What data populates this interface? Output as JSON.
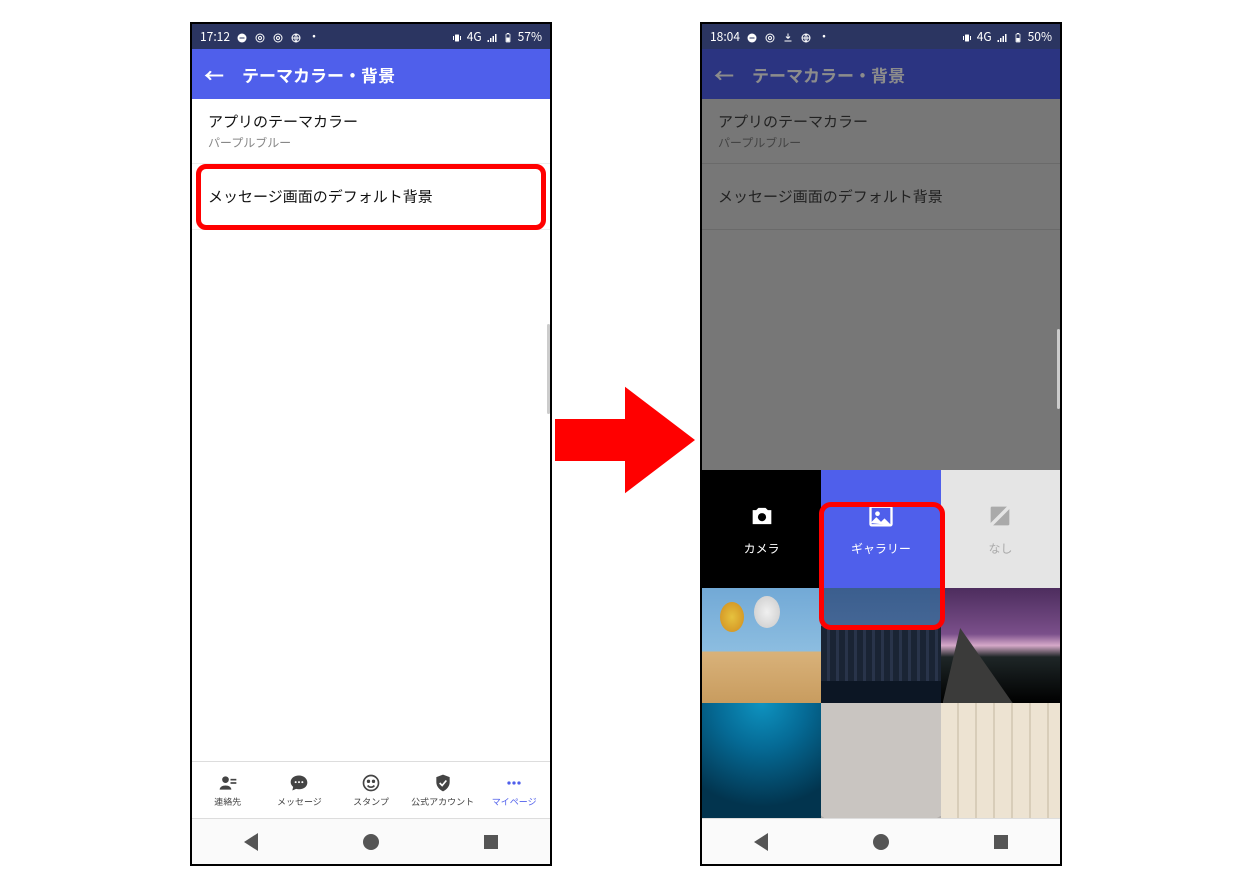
{
  "left_phone": {
    "status": {
      "time": "17:12",
      "network": "4G",
      "battery": "57%"
    },
    "header_title": "テーマカラー・背景",
    "row_theme": {
      "title": "アプリのテーマカラー",
      "sub": "パープルブルー"
    },
    "row_bg": {
      "title": "メッセージ画面のデフォルト背景"
    },
    "tabs": {
      "contacts": "連絡先",
      "messages": "メッセージ",
      "stamps": "スタンプ",
      "official": "公式アカウント",
      "mypage": "マイページ"
    }
  },
  "right_phone": {
    "status": {
      "time": "18:04",
      "network": "4G",
      "battery": "50%"
    },
    "header_title": "テーマカラー・背景",
    "row_theme": {
      "title": "アプリのテーマカラー",
      "sub": "パープルブルー"
    },
    "row_bg": {
      "title": "メッセージ画面のデフォルト背景"
    },
    "options": {
      "camera": "カメラ",
      "gallery": "ギャラリー",
      "none": "なし"
    }
  }
}
